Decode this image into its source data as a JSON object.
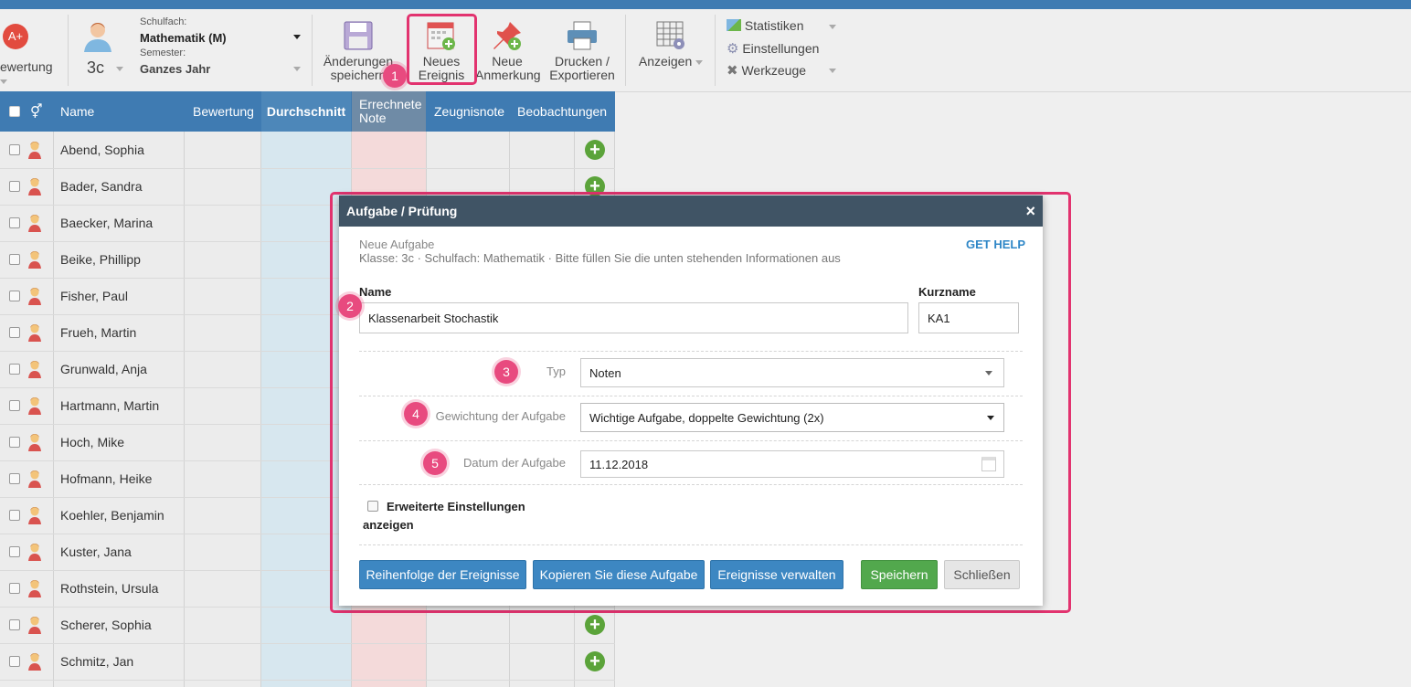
{
  "toolbar": {
    "grade_label": "ewertung",
    "subject_caption": "Schulfach:",
    "subject_value": "Mathematik (M)",
    "semester_caption": "Semester:",
    "semester_value": "Ganzes Jahr",
    "class_value": "3c",
    "save_label_1": "Änderungen",
    "save_label_2": "speichern",
    "new_event_1": "Neues",
    "new_event_2": "Ereignis",
    "new_note_1": "Neue",
    "new_note_2": "Anmerkung",
    "print_1": "Drucken /",
    "print_2": "Exportieren",
    "view_label": "Anzeigen",
    "menu": [
      "Statistiken",
      "Einstellungen",
      "Werkzeuge"
    ]
  },
  "grid": {
    "headers": {
      "name": "Name",
      "rating": "Bewertung",
      "average": "Durchschnitt",
      "calc_1": "Errechnete",
      "calc_2": "Note",
      "report": "Zeugnisnote",
      "obs": "Beobachtungen"
    },
    "students": [
      "Abend, Sophia",
      "Bader, Sandra",
      "Baecker, Marina",
      "Beike, Phillipp",
      "Fisher, Paul",
      "Frueh, Martin",
      "Grunwald, Anja",
      "Hartmann, Martin",
      "Hoch, Mike",
      "Hofmann, Heike",
      "Koehler, Benjamin",
      "Kuster, Jana",
      "Rothstein, Ursula",
      "Scherer, Sophia",
      "Schmitz, Jan"
    ]
  },
  "modal": {
    "title": "Aufgabe / Prüfung",
    "close": "×",
    "subtitle": "Neue Aufgabe",
    "info": "Klasse: 3c · Schulfach: Mathematik · Bitte füllen Sie die unten stehenden Informationen aus",
    "help": "GET HELP",
    "name_label": "Name",
    "name_value": "Klassenarbeit Stochastik",
    "short_label": "Kurzname",
    "short_value": "KA1",
    "type_label": "Typ",
    "type_value": "Noten",
    "weight_label": "Gewichtung der Aufgabe",
    "weight_value": "Wichtige Aufgabe, doppelte Gewichtung (2x)",
    "date_label": "Datum der Aufgabe",
    "date_value": "11.12.2018",
    "advanced_1": "Erweiterte Einstellungen",
    "advanced_2": "anzeigen",
    "buttons": {
      "order": "Reihenfolge der Ereignisse",
      "copy": "Kopieren Sie diese Aufgabe",
      "manage": "Ereignisse verwalten",
      "save": "Speichern",
      "close": "Schließen"
    }
  },
  "badges": [
    "1",
    "2",
    "3",
    "4",
    "5"
  ],
  "colors": {
    "header_blue": "#3f7bb2",
    "highlight_pink": "#e2336f",
    "modal_header": "#405465",
    "primary_button": "#3d87c2",
    "success_button": "#52a84d"
  }
}
